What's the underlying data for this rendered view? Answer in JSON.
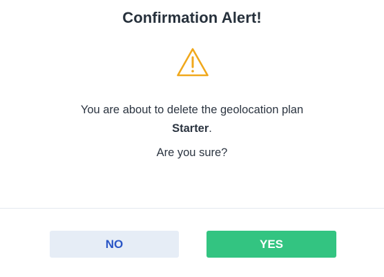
{
  "dialog": {
    "title": "Confirmation Alert!",
    "icon": "warning-triangle-icon",
    "message_prefix": "You are about to delete the geolocation plan",
    "plan_name": "Starter",
    "message_suffix": ".",
    "question": "Are you sure?",
    "buttons": {
      "no_label": "NO",
      "yes_label": "YES"
    },
    "colors": {
      "warning": "#f0a81c",
      "no_bg": "#e6edf6",
      "no_text": "#2a56c6",
      "yes_bg": "#33c481",
      "yes_text": "#ffffff"
    }
  }
}
